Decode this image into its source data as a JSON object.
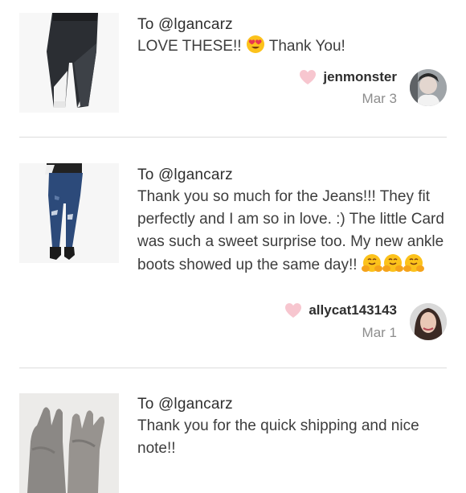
{
  "notes": [
    {
      "to": "To @lgancarz",
      "message_before_emoji": "LOVE THESE!! ",
      "message_after_emoji": " Thank You!",
      "emoji": "heart-eyes-emoji",
      "username": "jenmonster",
      "date": "Mar 3"
    },
    {
      "to": "To @lgancarz",
      "message": "Thank you so much for the Jeans!!! They fit perfectly and I am so in love. :) The little Card was such a sweet surprise too. My new ankle boots showed up the same day!! ",
      "emoji": "hugging-face-emoji",
      "username": "allycat143143",
      "date": "Mar 1"
    },
    {
      "to": "To @lgancarz",
      "message": "Thank you for the quick shipping and nice note!!"
    }
  ],
  "colors": {
    "heart": "#f7c6cf",
    "divider": "#dcdcdc",
    "date": "#8d8d8d"
  }
}
